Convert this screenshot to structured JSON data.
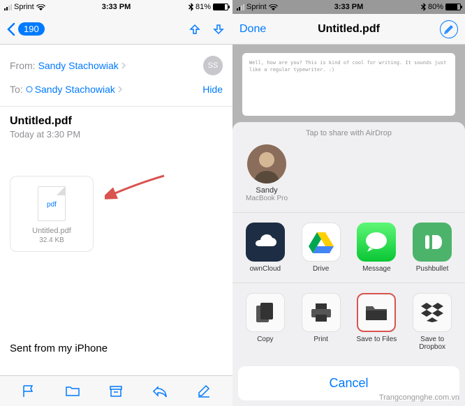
{
  "left": {
    "status": {
      "carrier": "Sprint",
      "time": "3:33 PM",
      "bluetooth": true,
      "battery": "81%"
    },
    "nav": {
      "unread_badge": "190"
    },
    "email": {
      "from_label": "From:",
      "from_value": "Sandy Stachowiak",
      "from_initials": "SS",
      "to_label": "To:",
      "to_value": "Sandy Stachowiak",
      "hide": "Hide",
      "subject": "Untitled.pdf",
      "date": "Today at 3:30 PM"
    },
    "attachment": {
      "ext": "pdf",
      "name": "Untitled.pdf",
      "size": "32.4 KB"
    },
    "signature": "Sent from my iPhone"
  },
  "right": {
    "status": {
      "carrier": "Sprint",
      "time": "3:33 PM",
      "battery": "80%"
    },
    "nav": {
      "done": "Done",
      "title": "Untitled.pdf"
    },
    "preview_text": "Well, how are you? This is kind of cool for writing. It sounds just like a regular typewriter. :)",
    "share": {
      "airdrop_hint": "Tap to share with AirDrop",
      "contact": {
        "name": "Sandy",
        "device": "MacBook Pro"
      },
      "apps": [
        {
          "label": "ownCloud"
        },
        {
          "label": "Drive"
        },
        {
          "label": "Message"
        },
        {
          "label": "Pushbullet"
        }
      ],
      "actions": [
        {
          "label": "Copy"
        },
        {
          "label": "Print"
        },
        {
          "label": "Save to Files"
        },
        {
          "label": "Save to Dropbox"
        }
      ],
      "cancel": "Cancel"
    }
  },
  "watermark": "Trangcongnghe.com.vn"
}
